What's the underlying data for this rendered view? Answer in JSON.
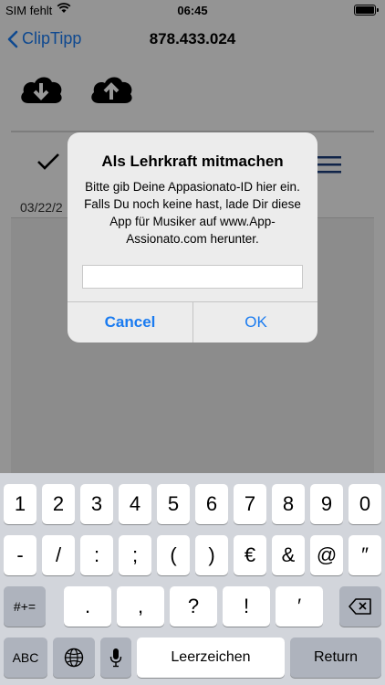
{
  "status": {
    "carrier": "SIM fehlt",
    "time": "06:45"
  },
  "nav": {
    "back_label": "ClipTipp",
    "title": "878.433.024"
  },
  "content": {
    "date_text": "03/22/2"
  },
  "alert": {
    "title": "Als Lehrkraft mitmachen",
    "message": "Bitte gib Deine Appasionato-ID hier ein. Falls Du noch keine hast, lade Dir diese App für Musiker auf www.App-Assionato.com herunter.",
    "input_value": "",
    "cancel_label": "Cancel",
    "ok_label": "OK"
  },
  "keyboard": {
    "row1": [
      "1",
      "2",
      "3",
      "4",
      "5",
      "6",
      "7",
      "8",
      "9",
      "0"
    ],
    "row2": [
      "-",
      "/",
      ":",
      ";",
      "(",
      ")",
      "€",
      "&",
      "@",
      "″"
    ],
    "row3": [
      ".",
      ",",
      "?",
      "!",
      "′"
    ],
    "shift_label": "#+=",
    "abc_label": "ABC",
    "space_label": "Leerzeichen",
    "return_label": "Return"
  },
  "icons": {
    "back": "chevron-left-icon",
    "wifi": "wifi-icon",
    "battery": "battery-icon",
    "download": "cloud-download-icon",
    "upload": "cloud-upload-icon",
    "check": "checkmark-icon",
    "menu": "hamburger-icon",
    "globe": "globe-icon",
    "mic": "microphone-icon",
    "delete": "delete-icon"
  },
  "colors": {
    "accent": "#1a7bf0"
  }
}
